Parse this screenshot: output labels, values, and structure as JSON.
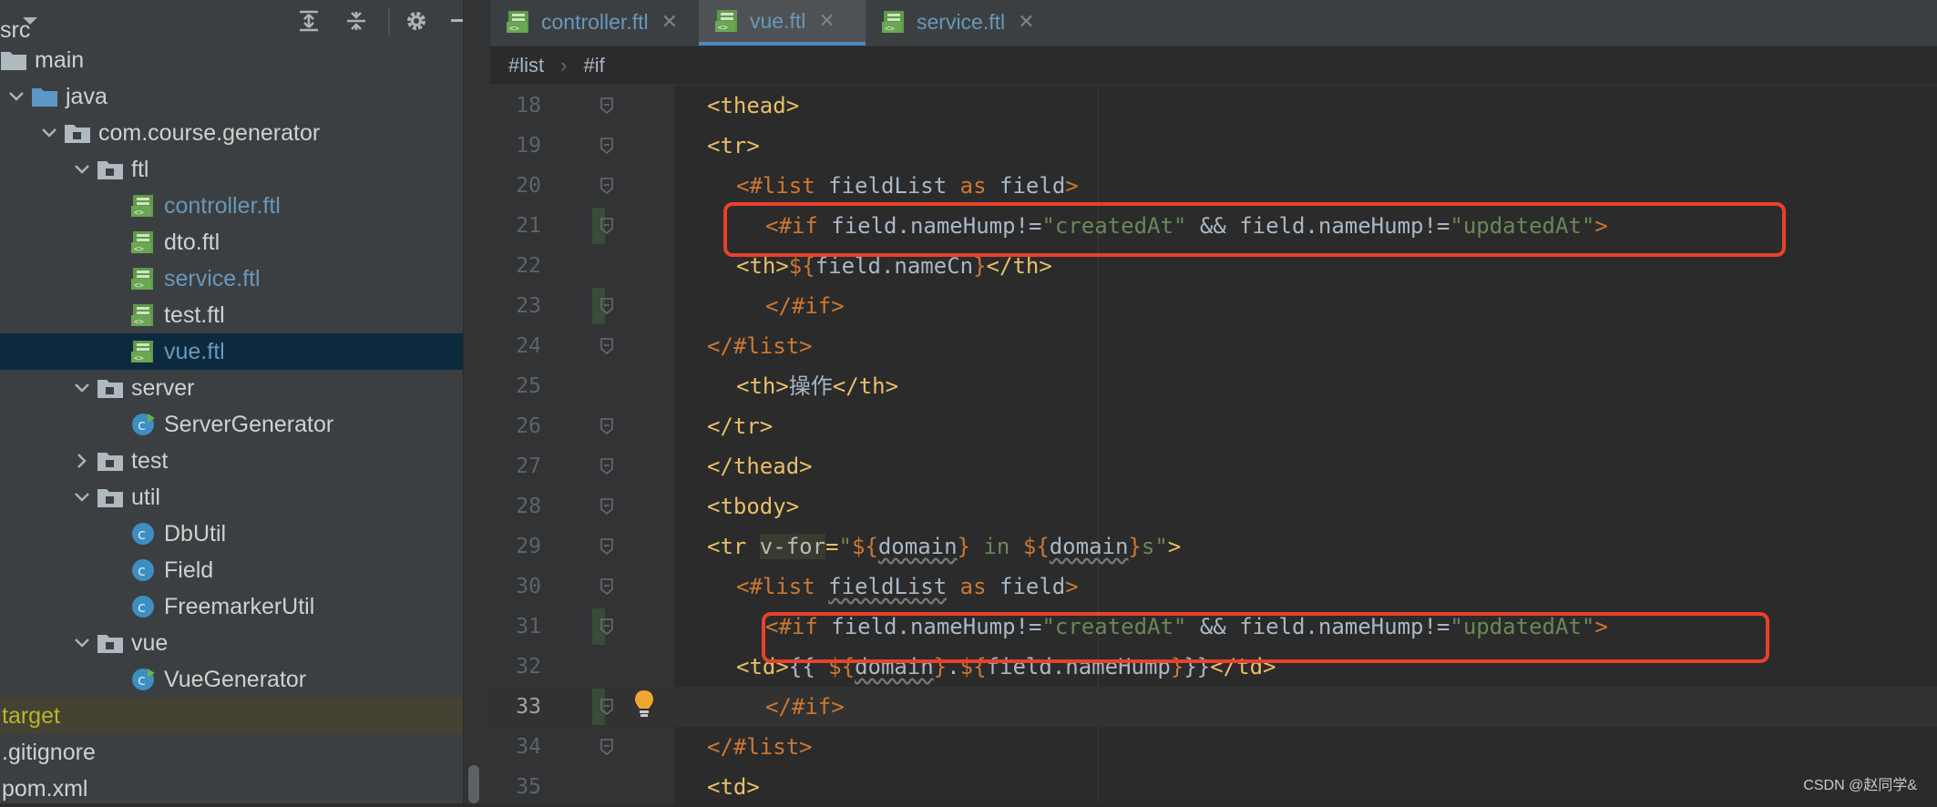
{
  "sidebar": {
    "top_partial": "src",
    "tree": [
      {
        "label": "main",
        "depth": 0,
        "type": "folder",
        "expand": "",
        "color": "#d0d0d0"
      },
      {
        "label": "java",
        "depth": 0,
        "type": "folder-blue",
        "expand": "open",
        "color": "#d0d0d0"
      },
      {
        "label": "com.course.generator",
        "depth": 1,
        "type": "package",
        "expand": "open",
        "color": "#d0d0d0"
      },
      {
        "label": "ftl",
        "depth": 2,
        "type": "package",
        "expand": "open",
        "color": "#d0d0d0"
      },
      {
        "label": "controller.ftl",
        "depth": 3,
        "type": "ftl",
        "expand": "",
        "color": "#6897bb"
      },
      {
        "label": "dto.ftl",
        "depth": 3,
        "type": "ftl",
        "expand": "",
        "color": "#d0d0d0"
      },
      {
        "label": "service.ftl",
        "depth": 3,
        "type": "ftl",
        "expand": "",
        "color": "#6897bb"
      },
      {
        "label": "test.ftl",
        "depth": 3,
        "type": "ftl",
        "expand": "",
        "color": "#d0d0d0"
      },
      {
        "label": "vue.ftl",
        "depth": 3,
        "type": "ftl",
        "expand": "",
        "color": "#6897bb",
        "selected": true
      },
      {
        "label": "server",
        "depth": 2,
        "type": "package",
        "expand": "open",
        "color": "#d0d0d0"
      },
      {
        "label": "ServerGenerator",
        "depth": 3,
        "type": "class-run",
        "expand": "",
        "color": "#d0d0d0"
      },
      {
        "label": "test",
        "depth": 2,
        "type": "package",
        "expand": "closed",
        "color": "#d0d0d0"
      },
      {
        "label": "util",
        "depth": 2,
        "type": "package",
        "expand": "open",
        "color": "#d0d0d0"
      },
      {
        "label": "DbUtil",
        "depth": 3,
        "type": "class",
        "expand": "",
        "color": "#d0d0d0"
      },
      {
        "label": "Field",
        "depth": 3,
        "type": "class",
        "expand": "",
        "color": "#d0d0d0"
      },
      {
        "label": "FreemarkerUtil",
        "depth": 3,
        "type": "class",
        "expand": "",
        "color": "#d0d0d0"
      },
      {
        "label": "vue",
        "depth": 2,
        "type": "package",
        "expand": "open",
        "color": "#d0d0d0"
      },
      {
        "label": "VueGenerator",
        "depth": 3,
        "type": "class-run",
        "expand": "",
        "color": "#d0d0d0"
      },
      {
        "label": "target",
        "depth": -1,
        "type": "none",
        "expand": "",
        "color": "#bbb529",
        "target": true
      },
      {
        "label": ".gitignore",
        "depth": -1,
        "type": "none",
        "expand": "",
        "color": "#d0d0d0"
      },
      {
        "label": "pom.xml",
        "depth": -1,
        "type": "none",
        "expand": "",
        "color": "#d0d0d0"
      }
    ]
  },
  "tabs": [
    {
      "label": "controller.ftl",
      "active": false
    },
    {
      "label": "vue.ftl",
      "active": true
    },
    {
      "label": "service.ftl",
      "active": false
    }
  ],
  "breadcrumb": [
    "#list",
    "#if"
  ],
  "code": {
    "current_line": 33,
    "lines": [
      {
        "n": "18",
        "indent": 2,
        "tokens": [
          [
            "tag",
            "<thead>"
          ]
        ]
      },
      {
        "n": "19",
        "indent": 2,
        "tokens": [
          [
            "tag",
            "<tr>"
          ]
        ]
      },
      {
        "n": "20",
        "indent": 4,
        "tokens": [
          [
            "dir",
            "<#list "
          ],
          [
            "txt",
            "fieldList "
          ],
          [
            "kw",
            "as "
          ],
          [
            "txt",
            "field"
          ],
          [
            "dir",
            ">"
          ]
        ]
      },
      {
        "n": "21",
        "indent": 6,
        "tokens": [
          [
            "dir",
            "<#if "
          ],
          [
            "txt",
            "field.nameHump!="
          ],
          [
            "str",
            "\"createdAt\""
          ],
          [
            "txt",
            " && field.nameHump!="
          ],
          [
            "str",
            "\"updatedAt\""
          ],
          [
            "dir",
            ">"
          ]
        ]
      },
      {
        "n": "22",
        "indent": 4,
        "tokens": [
          [
            "tag",
            "<th>"
          ],
          [
            "dir",
            "${"
          ],
          [
            "txt",
            "field.nameCn"
          ],
          [
            "dir",
            "}"
          ],
          [
            "tag",
            "</th>"
          ]
        ]
      },
      {
        "n": "23",
        "indent": 6,
        "tokens": [
          [
            "dir",
            "</#if>"
          ]
        ]
      },
      {
        "n": "24",
        "indent": 2,
        "tokens": [
          [
            "dir",
            "</#list>"
          ]
        ]
      },
      {
        "n": "25",
        "indent": 4,
        "tokens": [
          [
            "tag",
            "<th>"
          ],
          [
            "txt",
            "操作"
          ],
          [
            "tag",
            "</th>"
          ]
        ]
      },
      {
        "n": "26",
        "indent": 2,
        "tokens": [
          [
            "tag",
            "</tr>"
          ]
        ]
      },
      {
        "n": "27",
        "indent": 2,
        "tokens": [
          [
            "tag",
            "</thead>"
          ]
        ]
      },
      {
        "n": "28",
        "indent": 2,
        "tokens": [
          [
            "tag",
            "<tbody>"
          ]
        ]
      },
      {
        "n": "29",
        "indent": 2,
        "tokens": [
          [
            "tag",
            "<tr "
          ],
          [
            "attrhl",
            "v-for"
          ],
          [
            "tag",
            "="
          ],
          [
            "str",
            "\""
          ],
          [
            "dir",
            "${"
          ],
          [
            "wavy",
            "domain"
          ],
          [
            "dir",
            "}"
          ],
          [
            "str",
            " in "
          ],
          [
            "dir",
            "${"
          ],
          [
            "wavy",
            "domain"
          ],
          [
            "dir",
            "}"
          ],
          [
            "str",
            "s\""
          ],
          [
            "tag",
            ">"
          ]
        ]
      },
      {
        "n": "30",
        "indent": 4,
        "tokens": [
          [
            "dir",
            "<#list "
          ],
          [
            "wavy",
            "fieldList"
          ],
          [
            "kw",
            " as "
          ],
          [
            "txt",
            "field"
          ],
          [
            "dir",
            ">"
          ]
        ]
      },
      {
        "n": "31",
        "indent": 6,
        "tokens": [
          [
            "dir",
            "<#if "
          ],
          [
            "txt",
            "field.nameHump!="
          ],
          [
            "str",
            "\"createdAt\""
          ],
          [
            "txt",
            " && field.nameHump!="
          ],
          [
            "str",
            "\"updatedAt\""
          ],
          [
            "dir",
            ">"
          ]
        ]
      },
      {
        "n": "32",
        "indent": 4,
        "tokens": [
          [
            "tag",
            "<td>"
          ],
          [
            "txt",
            "{{ "
          ],
          [
            "dir",
            "${"
          ],
          [
            "wavy",
            "domain"
          ],
          [
            "dir",
            "}"
          ],
          [
            "txt",
            "."
          ],
          [
            "dir",
            "${"
          ],
          [
            "txt",
            "field.nameHump"
          ],
          [
            "dir",
            "}"
          ],
          [
            "txt",
            "}}"
          ],
          [
            "tag",
            "</td>"
          ]
        ]
      },
      {
        "n": "33",
        "indent": 6,
        "tokens": [
          [
            "dir",
            "</#if>"
          ]
        ]
      },
      {
        "n": "34",
        "indent": 2,
        "tokens": [
          [
            "dir",
            "</#list>"
          ]
        ]
      },
      {
        "n": "35",
        "indent": 2,
        "tokens": [
          [
            "tag",
            "<td>"
          ]
        ]
      }
    ]
  },
  "watermark": "CSDN @赵同学&",
  "colors": {
    "highlight_box": "#e8412c",
    "selected_row": "#0d293e",
    "accent_tab": "#4a88c7"
  }
}
